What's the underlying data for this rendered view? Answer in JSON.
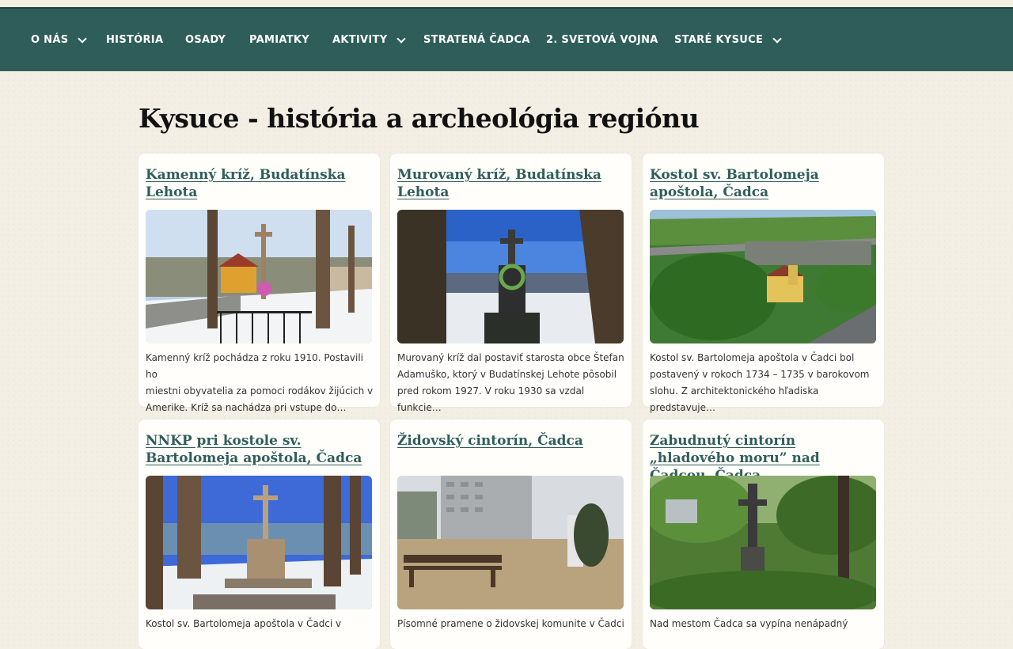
{
  "nav": {
    "items": [
      {
        "label": "O NÁS",
        "dropdown": true
      },
      {
        "label": "HISTÓRIA",
        "dropdown": false
      },
      {
        "label": "OSADY",
        "dropdown": false
      },
      {
        "label": "PAMIATKY",
        "dropdown": false
      },
      {
        "label": "AKTIVITY",
        "dropdown": true
      },
      {
        "label": "STRATENÁ ČADCA",
        "dropdown": false
      },
      {
        "label": "2. SVETOVÁ VOJNA",
        "dropdown": false
      },
      {
        "label": "STARÉ KYSUCE",
        "dropdown": true
      }
    ]
  },
  "page": {
    "title": "Kysuce - história a archeológia regiónu"
  },
  "cards": [
    {
      "title": "Kamenný kríž, Budatínska Lehota",
      "excerpt_lines": [
        "Kamenný kríž pochádza z roku 1910. Postavili ho",
        "miestni obyvatelia za pomoci rodákov žijúcich v",
        "Amerike. Kríž sa nachádza pri vstupe do…"
      ]
    },
    {
      "title": "Murovaný kríž, Budatínska Lehota",
      "excerpt_lines": [
        "Murovaný kríž dal postaviť starosta obce Štefan",
        "Adamuško, ktorý v Budatínskej Lehote pôsobil",
        "pred rokom 1927. V roku 1930 sa vzdal funkcie…"
      ]
    },
    {
      "title": "Kostol sv. Bartolomeja apoštola, Čadca",
      "excerpt_lines": [
        "Kostol sv. Bartolomeja apoštola v Čadci bol",
        "postavený v rokoch 1734 – 1735 v barokovom",
        "slohu. Z architektonického hľadiska predstavuje…"
      ]
    },
    {
      "title": "NNKP pri kostole sv. Bartolomeja apoštola, Čadca",
      "excerpt_lines": [
        "Kostol sv. Bartolomeja apoštola v Čadci v"
      ]
    },
    {
      "title": "Židovský cintorín, Čadca",
      "excerpt_lines": [
        "Písomné pramene o židovskej komunite v Čadci"
      ]
    },
    {
      "title": "Zabudnutý cintorín „hladového moru” nad Čadcou, Čadca",
      "excerpt_lines": [
        "Nad mestom Čadca sa vypína nenápadný"
      ]
    }
  ]
}
